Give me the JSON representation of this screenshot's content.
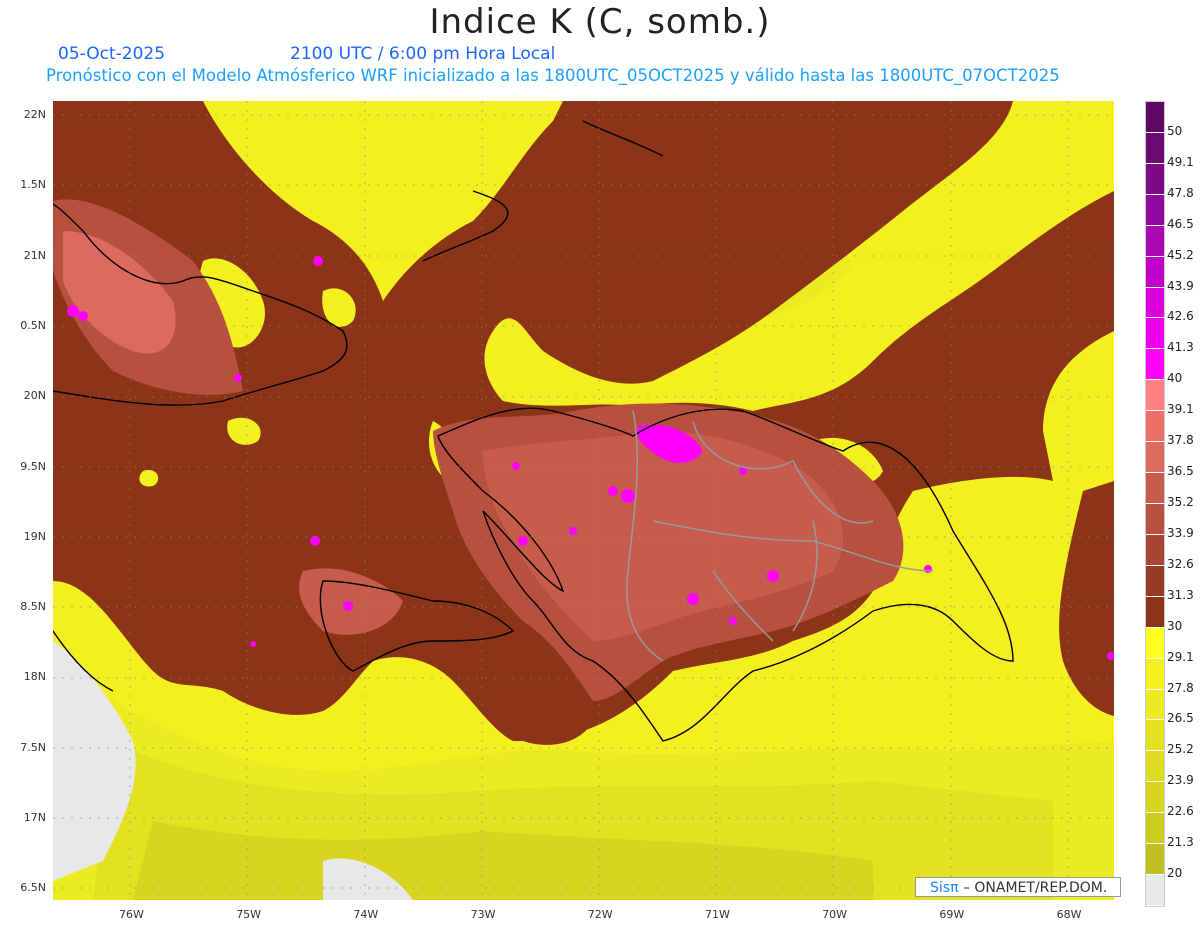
{
  "title": "Indice K (C, somb.)",
  "date": "05-Oct-2025",
  "time": "2100 UTC / 6:00 pm Hora Local",
  "forecast": "Pronóstico con el Modelo Atmósferico WRF inicializado a las 1800UTC_05OCT2025 y válido hasta las  1800UTC_07OCT2025",
  "lat_labels": [
    "22N",
    "1.5N",
    "21N",
    "0.5N",
    "20N",
    "9.5N",
    "19N",
    "8.5N",
    "18N",
    "7.5N",
    "17N",
    "6.5N"
  ],
  "lon_labels": [
    "76W",
    "75W",
    "74W",
    "73W",
    "72W",
    "71W",
    "70W",
    "69W",
    "68W"
  ],
  "colorbar": {
    "labels": [
      "50",
      "49.1",
      "47.8",
      "46.5",
      "45.2",
      "43.9",
      "42.6",
      "41.3",
      "40",
      "39.1",
      "37.8",
      "36.5",
      "35.2",
      "33.9",
      "32.6",
      "31.3",
      "30",
      "29.1",
      "27.8",
      "26.5",
      "25.2",
      "23.9",
      "22.6",
      "21.3",
      "20"
    ],
    "colors": [
      "#5e0866",
      "#6c0a74",
      "#7c0a86",
      "#9008a0",
      "#a808b4",
      "#c000c8",
      "#dc00dc",
      "#ec00ec",
      "#ff00ff",
      "#ff8080",
      "#ec7068",
      "#dc6a5e",
      "#c85c4c",
      "#b85040",
      "#a84434",
      "#983a28",
      "#8b3418",
      "#ffff20",
      "#f4f020",
      "#ecea20",
      "#e4e220",
      "#dedc20",
      "#d8d420",
      "#cccc20",
      "#c0c020",
      "#e8e8e8"
    ]
  },
  "credit": {
    "brand": "Sisπ",
    "text": " –  ONAMET/REP.DOM."
  }
}
